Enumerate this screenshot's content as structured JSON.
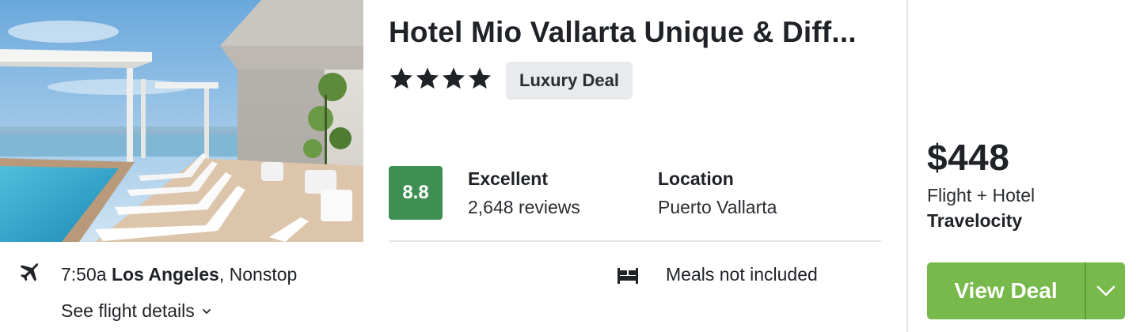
{
  "hotel": {
    "name": "Hotel Mio Vallarta Unique & Diff...",
    "star_count": 4,
    "badge": "Luxury Deal",
    "score": "8.8",
    "rating_word": "Excellent",
    "review_count": "2,648 reviews",
    "location_label": "Location",
    "location_value": "Puerto Vallarta",
    "meals": "Meals not included",
    "photo_icon": "hotel-photo"
  },
  "flight": {
    "time": "7:50a",
    "origin": "Los Angeles",
    "stops": ", Nonstop",
    "details_link": "See flight details",
    "icon": "plane-icon"
  },
  "offer": {
    "price": "$448",
    "package": "Flight + Hotel",
    "provider": "Travelocity",
    "button_label": "View Deal"
  },
  "colors": {
    "score_green": "#3f8f53",
    "deal_button_green": "#77b94a",
    "badge_gray": "#e8eaed",
    "text_dark": "#1f2226"
  }
}
